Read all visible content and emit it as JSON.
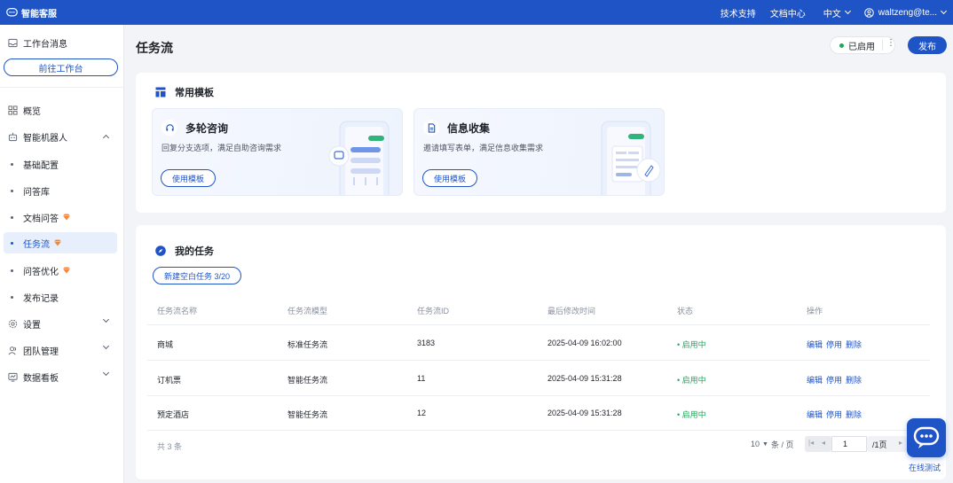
{
  "topbar": {
    "brand": "智能客服",
    "links": [
      "技术支持",
      "文档中心"
    ],
    "language": "中文",
    "user": "waltzeng@te..."
  },
  "sidebar": {
    "workbench_msg": "工作台消息",
    "goto_workbench": "前往工作台",
    "overview": "概览",
    "robot": "智能机器人",
    "robot_items": [
      "基础配置",
      "问答库",
      "文档问答",
      "任务流",
      "问答优化",
      "发布记录"
    ],
    "settings": "设置",
    "team": "团队管理",
    "dashboard": "数据看板"
  },
  "header": {
    "title": "任务流",
    "status": "已启用",
    "more": "⋮",
    "publish": "发布"
  },
  "templates": {
    "section_title": "常用模板",
    "items": [
      {
        "name": "多轮咨询",
        "desc": "回复分支选项，满足自助咨询需求",
        "button": "使用模板"
      },
      {
        "name": "信息收集",
        "desc": "邀请填写表单，满足信息收集需求",
        "button": "使用模板"
      }
    ]
  },
  "tasks": {
    "section_title": "我的任务",
    "new_button": "新建空白任务 3/20",
    "columns": [
      "任务流名称",
      "任务流模型",
      "任务流ID",
      "最后修改时间",
      "状态",
      "操作"
    ],
    "rows": [
      {
        "name": "商城",
        "model": "标准任务流",
        "id": "3183",
        "time": "2025-04-09 16:02:00",
        "status": "启用中"
      },
      {
        "name": "订机票",
        "model": "智能任务流",
        "id": "11",
        "time": "2025-04-09 15:31:28",
        "status": "启用中"
      },
      {
        "name": "预定酒店",
        "model": "智能任务流",
        "id": "12",
        "time": "2025-04-09 15:31:28",
        "status": "启用中"
      }
    ],
    "actions": [
      "编辑",
      "停用",
      "删除"
    ],
    "total": "共 3 条",
    "page_size": "10",
    "page_size_unit": "条 / 页",
    "page_input": "1",
    "page_total": "/1页"
  },
  "float": {
    "label": "在线测试"
  },
  "colors": {
    "primary": "#1f54c7",
    "success": "#1ea85a",
    "badge": "#f0883e"
  }
}
